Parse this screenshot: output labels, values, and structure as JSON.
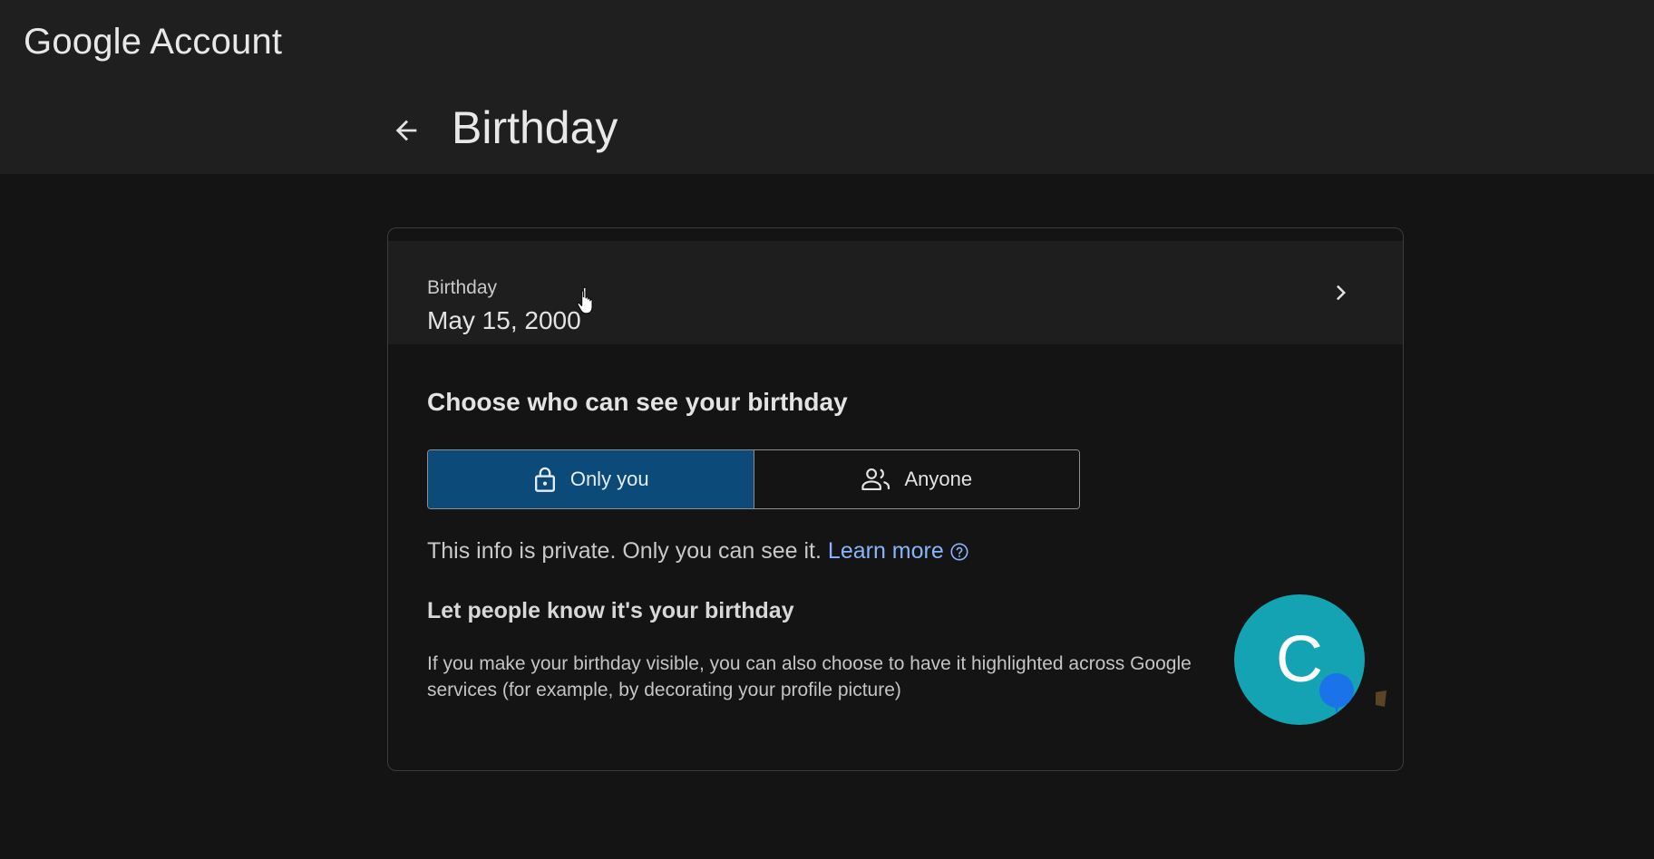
{
  "header": {
    "brand": "Google Account",
    "title": "Birthday",
    "back_icon": "arrow-back-icon"
  },
  "birthday_row": {
    "label": "Birthday",
    "value": "May 15, 2000",
    "chevron_icon": "chevron-right-icon"
  },
  "visibility": {
    "title": "Choose who can see your birthday",
    "options": [
      {
        "label": "Only you",
        "icon": "lock-icon",
        "selected": true
      },
      {
        "label": "Anyone",
        "icon": "people-icon",
        "selected": false
      }
    ],
    "info_text": "This info is private. Only you can see it.",
    "learn_more": "Learn more"
  },
  "highlight": {
    "title": "Let people know it's your birthday",
    "description": "If you make your birthday visible, you can also choose to have it highlighted across Google services (for example, by decorating your profile picture)",
    "avatar_letter": "C"
  },
  "colors": {
    "selected_segment": "#0c4a7a",
    "link": "#8ab4f8",
    "avatar": "#14a3b3",
    "balloon": "#1a73e8"
  }
}
